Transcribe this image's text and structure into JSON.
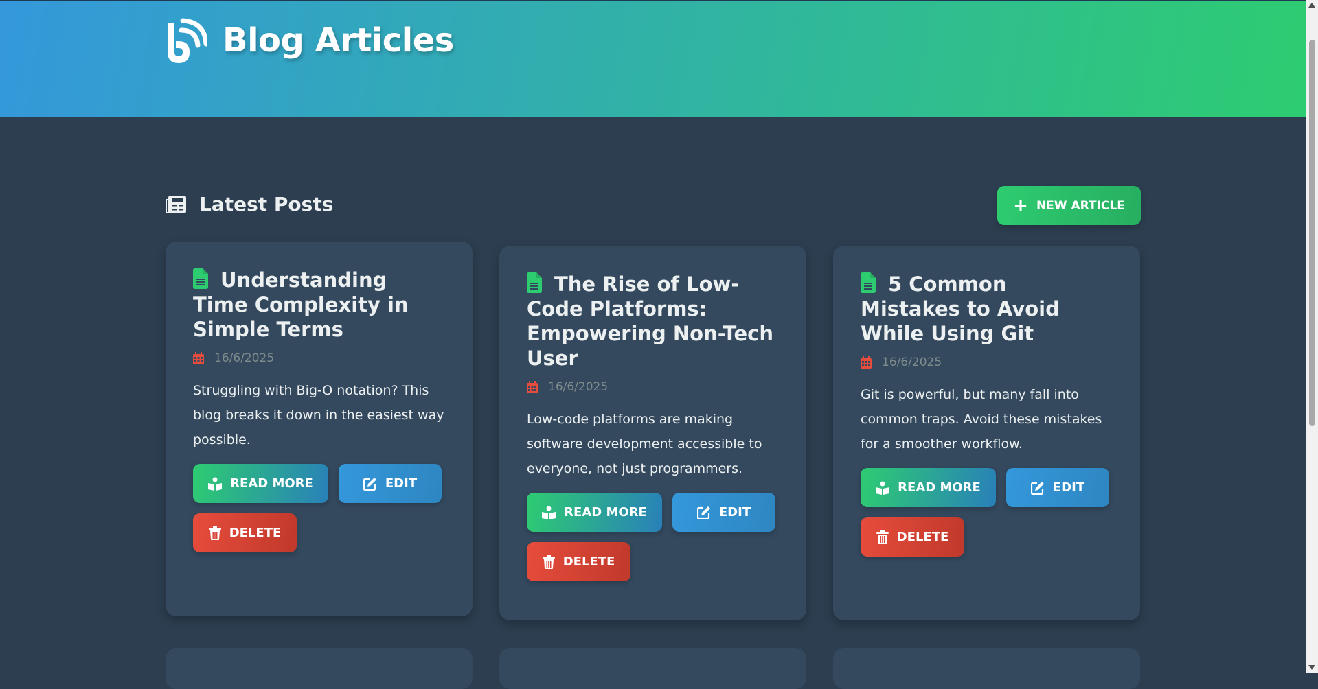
{
  "header": {
    "title": "Blog Articles",
    "logo_icon": "blogger-icon"
  },
  "section": {
    "title": "Latest Posts",
    "icon": "newspaper-icon"
  },
  "new_article": {
    "label": "NEW ARTICLE",
    "icon": "plus-icon"
  },
  "colors": {
    "header_gradient_start": "#3498db",
    "header_gradient_end": "#2ecc71",
    "background": "#2c3e50",
    "card": "#34495e",
    "read": "#2ecc71",
    "edit": "#3498db",
    "delete": "#e74c3c"
  },
  "articles": [
    {
      "title": "Understanding Time Complexity in Simple Terms",
      "date": "16/6/2025",
      "excerpt": "Struggling with Big-O notation? This blog breaks it down in the easiest way possible.",
      "read_label": "READ MORE",
      "edit_label": "EDIT",
      "delete_label": "DELETE"
    },
    {
      "title": "The Rise of Low-Code Platforms: Empowering Non-Tech User",
      "date": "16/6/2025",
      "excerpt": "Low-code platforms are making software development accessible to everyone, not just programmers.",
      "read_label": "READ MORE",
      "edit_label": "EDIT",
      "delete_label": "DELETE"
    },
    {
      "title": "5 Common Mistakes to Avoid While Using Git",
      "date": "16/6/2025",
      "excerpt": "Git is powerful, but many fall into common traps. Avoid these mistakes for a smoother workflow.",
      "read_label": "READ MORE",
      "edit_label": "EDIT",
      "delete_label": "DELETE"
    }
  ]
}
